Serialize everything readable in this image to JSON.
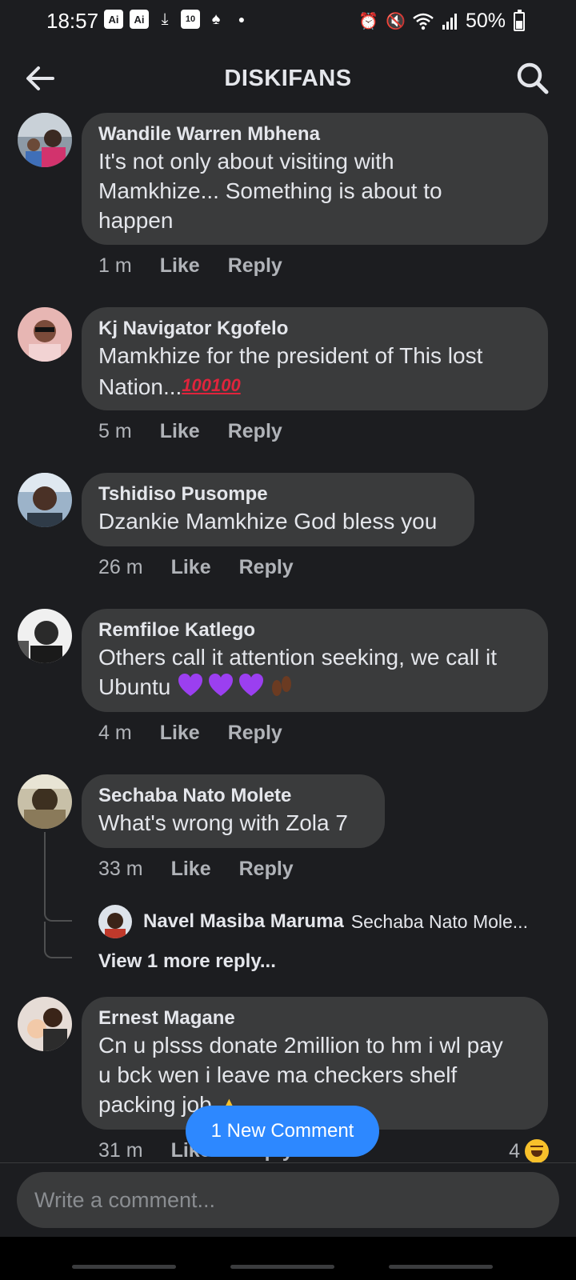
{
  "status_bar": {
    "time": "18:57",
    "battery": "50%",
    "left_icons": [
      "ai-icon",
      "ai-icon",
      "download-icon",
      "calendar-icon",
      "notification-icon",
      "dot-icon"
    ],
    "right_icons": [
      "alarm-icon",
      "mute-icon",
      "wifi-icon",
      "signal-icon",
      "battery-icon"
    ],
    "badge_ai": "Ai",
    "badge_calendar": "10"
  },
  "header": {
    "title": "DISKIFANS",
    "back_icon": "arrow-left-icon",
    "search_icon": "search-icon"
  },
  "comments": [
    {
      "author": "Wandile Warren Mbhena",
      "lines": [
        "It's not only about visiting with",
        "Mamkhize... Something is about to",
        "happen"
      ],
      "time": "1 m",
      "like": "Like",
      "reply": "Reply"
    },
    {
      "author": "Kj Navigator Kgofelo",
      "lines": [
        "Mamkhize for the president of This lost",
        "Nation..."
      ],
      "emoji": "💯💯",
      "emoji_label": "100",
      "time": "5 m",
      "like": "Like",
      "reply": "Reply"
    },
    {
      "author": "Tshidiso Pusompe",
      "lines": [
        "Dzankie Mamkhize God bless you"
      ],
      "time": "26 m",
      "like": "Like",
      "reply": "Reply"
    },
    {
      "author": "Remfiloe Katlego",
      "lines": [
        "Others call it attention seeking, we call it",
        "Ubuntu"
      ],
      "emoji": "💜💜💜👣",
      "time": "4 m",
      "like": "Like",
      "reply": "Reply"
    },
    {
      "author": "Sechaba Nato Molete",
      "lines": [
        "What's wrong with Zola 7"
      ],
      "time": "33 m",
      "like": "Like",
      "reply": "Reply",
      "replies": {
        "author": "Navel Masiba Maruma",
        "preview": "Sechaba Nato Mole...",
        "view_more": "View 1 more reply..."
      }
    },
    {
      "author": "Ernest Magane",
      "lines": [
        "Cn u plsss donate 2million to hm i wl pay",
        "u bck wen i leave ma checkers shelf",
        "packing job"
      ],
      "emoji": "🙏",
      "time": "31 m",
      "like": "Like",
      "reply": "Reply",
      "reaction_count": "4",
      "reaction_icon": "laughing-emoji-icon"
    }
  ],
  "new_comment_pill": "1 New Comment",
  "composer": {
    "placeholder": "Write a comment..."
  },
  "colors": {
    "background": "#1c1d20",
    "bubble": "#3a3b3c",
    "accent": "#2d88ff",
    "meta_text": "#b0b3b8"
  }
}
